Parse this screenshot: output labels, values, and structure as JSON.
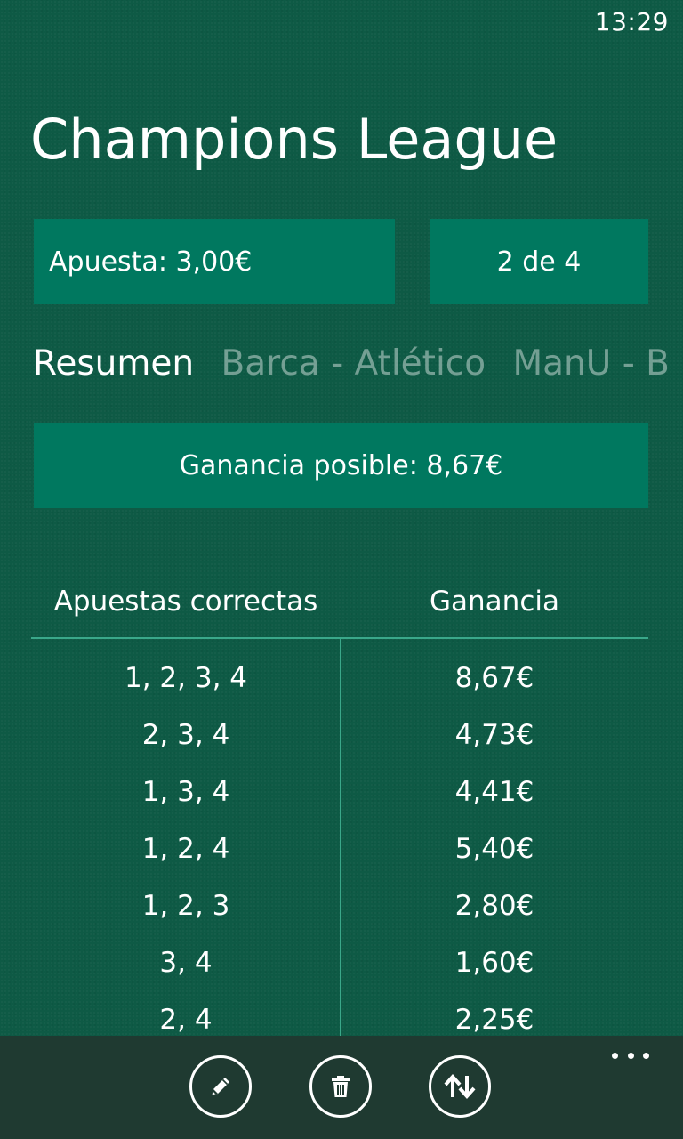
{
  "status_bar": {
    "time": "13:29"
  },
  "page": {
    "title": "Champions League"
  },
  "stake_tile": {
    "label": "Apuesta: 3,00€"
  },
  "combo_tile": {
    "label": "2 de 4"
  },
  "pivot": {
    "items": [
      {
        "label": "Resumen",
        "active": true
      },
      {
        "label": "Barca - Atlético",
        "active": false
      },
      {
        "label": "ManU - B",
        "active": false
      }
    ]
  },
  "winnings_tile": {
    "label": "Ganancia posible: 8,67€"
  },
  "table": {
    "headers": [
      "Apuestas correctas",
      "Ganancia"
    ],
    "rows": [
      [
        "1, 2, 3, 4",
        "8,67€"
      ],
      [
        "2, 3, 4",
        "4,73€"
      ],
      [
        "1, 3, 4",
        "4,41€"
      ],
      [
        "1, 2, 4",
        "5,40€"
      ],
      [
        "1, 2, 3",
        "2,80€"
      ],
      [
        "3, 4",
        "1,60€"
      ],
      [
        "2, 4",
        "2,25€"
      ]
    ]
  },
  "appbar": {
    "buttons": [
      {
        "icon": "pencil-icon"
      },
      {
        "icon": "trash-icon"
      },
      {
        "icon": "swap-arrows-icon"
      }
    ],
    "more_icon": "ellipsis-icon"
  },
  "colors": {
    "background": "#0e5a45",
    "tile": "#00785f",
    "table_line": "#3aa88a",
    "appbar": "#1f3a31",
    "inactive_text": "rgba(255,255,255,0.42)"
  }
}
